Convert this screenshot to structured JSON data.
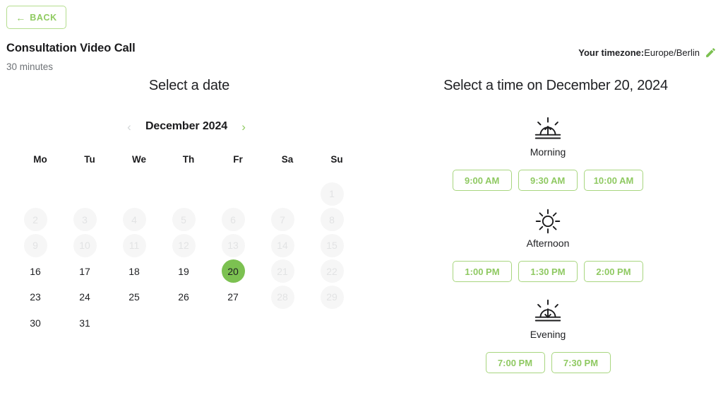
{
  "header": {
    "back_label": "BACK",
    "back_icon": "arrow-left-icon",
    "back_arrow": "←",
    "event_title": "Consultation Video Call",
    "event_duration": "30 minutes",
    "timezone_label": "Your timezone:",
    "timezone_value": "Europe/Berlin",
    "edit_icon": "pencil-edit-icon",
    "accent_green": "#8fcb60",
    "selected_green": "#7cc151",
    "slot_border_green": "#a8d67f"
  },
  "calendar": {
    "heading": "Select a date",
    "month_label": "December 2024",
    "prev_icon": "chevron-left-icon",
    "next_icon": "chevron-right-icon",
    "prev_glyph": "‹",
    "next_glyph": "›",
    "weekdays": [
      "Mo",
      "Tu",
      "We",
      "Th",
      "Fr",
      "Sa",
      "Su"
    ],
    "leading_blanks": 6,
    "days": [
      {
        "label": "1",
        "state": "disabled"
      },
      {
        "label": "2",
        "state": "disabled"
      },
      {
        "label": "3",
        "state": "disabled"
      },
      {
        "label": "4",
        "state": "disabled"
      },
      {
        "label": "5",
        "state": "disabled"
      },
      {
        "label": "6",
        "state": "disabled"
      },
      {
        "label": "7",
        "state": "disabled"
      },
      {
        "label": "8",
        "state": "disabled"
      },
      {
        "label": "9",
        "state": "disabled"
      },
      {
        "label": "10",
        "state": "disabled"
      },
      {
        "label": "11",
        "state": "disabled"
      },
      {
        "label": "12",
        "state": "disabled"
      },
      {
        "label": "13",
        "state": "disabled"
      },
      {
        "label": "14",
        "state": "disabled"
      },
      {
        "label": "15",
        "state": "disabled"
      },
      {
        "label": "16",
        "state": "available"
      },
      {
        "label": "17",
        "state": "available"
      },
      {
        "label": "18",
        "state": "available"
      },
      {
        "label": "19",
        "state": "available"
      },
      {
        "label": "20",
        "state": "selected"
      },
      {
        "label": "21",
        "state": "disabled"
      },
      {
        "label": "22",
        "state": "disabled"
      },
      {
        "label": "23",
        "state": "available"
      },
      {
        "label": "24",
        "state": "available"
      },
      {
        "label": "25",
        "state": "available"
      },
      {
        "label": "26",
        "state": "available"
      },
      {
        "label": "27",
        "state": "available"
      },
      {
        "label": "28",
        "state": "disabled"
      },
      {
        "label": "29",
        "state": "disabled"
      },
      {
        "label": "30",
        "state": "available"
      },
      {
        "label": "31",
        "state": "available"
      }
    ]
  },
  "times": {
    "heading": "Select a time on December 20, 2024",
    "sections": [
      {
        "label": "Morning",
        "icon": "sunrise-icon",
        "slots": [
          "9:00 AM",
          "9:30 AM",
          "10:00 AM"
        ]
      },
      {
        "label": "Afternoon",
        "icon": "sun-icon",
        "slots": [
          "1:00 PM",
          "1:30 PM",
          "2:00 PM"
        ]
      },
      {
        "label": "Evening",
        "icon": "sunset-icon",
        "slots": [
          "7:00 PM",
          "7:30 PM"
        ]
      }
    ]
  }
}
